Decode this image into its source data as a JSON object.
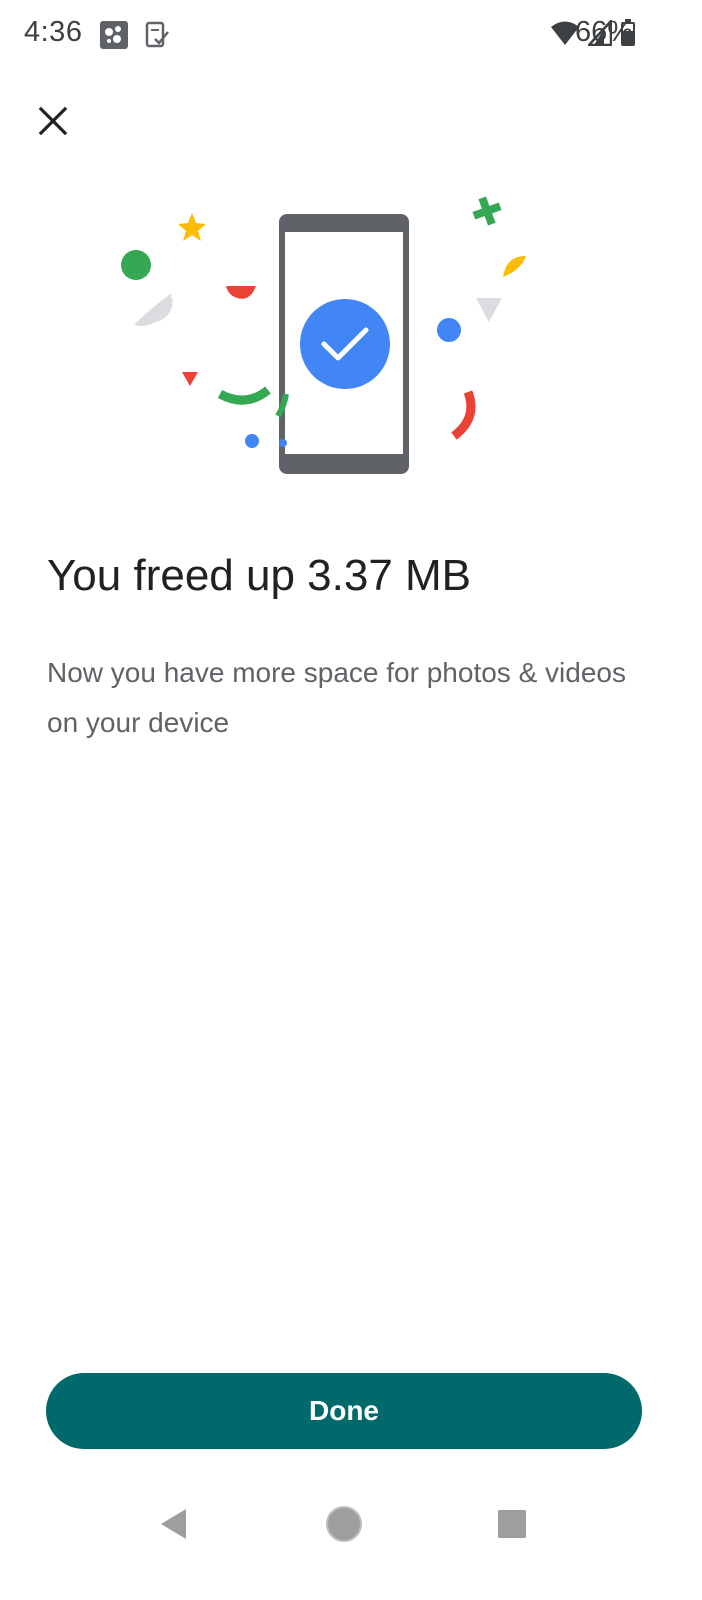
{
  "status_bar": {
    "time": "4:36",
    "battery_percent": "66%",
    "icons": [
      "game-notification-icon",
      "task-notification-icon",
      "wifi-icon",
      "cell-signal-icon",
      "battery-icon"
    ]
  },
  "header": {
    "close_icon": "close-icon"
  },
  "main": {
    "illustration_icon": "phone-check-confetti-illustration",
    "headline": "You freed up 3.37 MB",
    "description": "Now you have more space for photos & videos on your device"
  },
  "footer": {
    "done_label": "Done"
  },
  "nav_bar": {
    "icons": [
      "back-icon",
      "home-icon",
      "recents-icon"
    ]
  },
  "colors": {
    "primary": "#00696b",
    "blue": "#4285f4",
    "green": "#34a853",
    "red": "#ea4335",
    "yellow": "#fbbc04",
    "gray": "#dadce0"
  }
}
